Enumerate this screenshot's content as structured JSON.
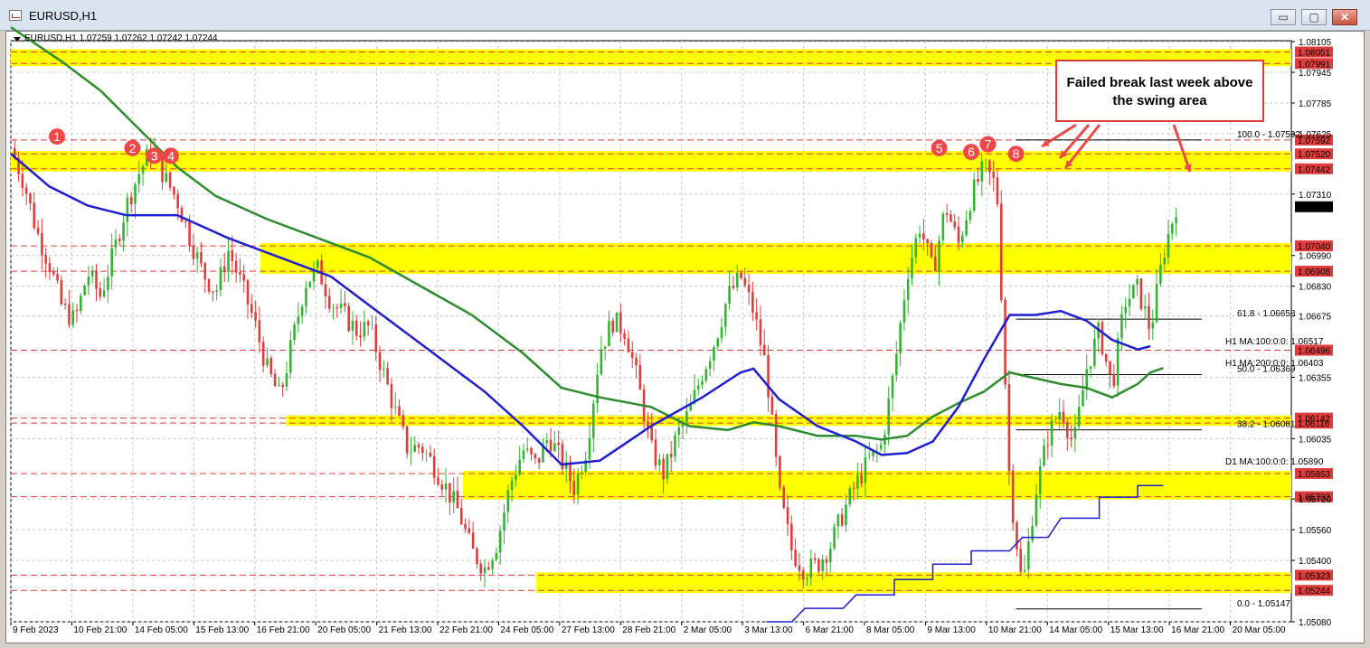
{
  "window": {
    "title": "EURUSD,H1",
    "header_symbol": "EURUSD,H1",
    "header_ohlc": "1.07259 1.07262 1.07242 1.07244",
    "minimize_glyph": "▭",
    "restore_glyph": "▢",
    "close_glyph": "✕"
  },
  "colors": {
    "bull": "#32b432",
    "bear": "#e03c3c",
    "ma100": "#1e1ed2",
    "ma200": "#2d8c2d",
    "zone": "#ffff00",
    "marker": "#f04848"
  },
  "chart_data": {
    "type": "candlestick",
    "symbol": "EURUSD",
    "timeframe": "H1",
    "last_price": "1.07244",
    "ylim": [
      1.0508,
      1.0811
    ],
    "y_ticks": [
      "1.08105",
      "1.07945",
      "1.07785",
      "1.07625",
      "1.07310",
      "1.06990",
      "1.06830",
      "1.06675",
      "1.06355",
      "1.06035",
      "1.05720",
      "1.05560",
      "1.05400",
      "1.05080"
    ],
    "x_ticks": [
      "9 Feb 2023",
      "10 Feb 21:00",
      "14 Feb 05:00",
      "15 Feb 13:00",
      "16 Feb 21:00",
      "20 Feb 05:00",
      "21 Feb 13:00",
      "22 Feb 21:00",
      "24 Feb 05:00",
      "27 Feb 13:00",
      "28 Feb 21:00",
      "2 Mar 05:00",
      "3 Mar 13:00",
      "6 Mar 21:00",
      "8 Mar 05:00",
      "9 Mar 13:00",
      "10 Mar 21:00",
      "14 Mar 05:00",
      "15 Mar 13:00",
      "16 Mar 21:00",
      "20 Mar 05:00"
    ],
    "price_labels": [
      "1.08051",
      "1.07991",
      "1.07592",
      "1.07520",
      "1.07442",
      "1.07040",
      "1.06908",
      "1.06496",
      "1.06142",
      "1.06116",
      "1.05853",
      "1.05732",
      "1.05323",
      "1.05244"
    ],
    "zones": [
      {
        "low": 1.07991,
        "high": 1.08051,
        "from": 0.0
      },
      {
        "low": 1.07442,
        "high": 1.0752,
        "from": 0.0
      },
      {
        "low": 1.06908,
        "high": 1.0704,
        "from": 0.195
      },
      {
        "low": 1.06116,
        "high": 1.06142,
        "from": 0.215
      },
      {
        "low": 1.05732,
        "high": 1.05853,
        "from": 0.353
      },
      {
        "low": 1.05244,
        "high": 1.05323,
        "from": 0.41
      }
    ],
    "fibonacci": [
      {
        "label": "100.0 - 1.07592",
        "level": 1.07592
      },
      {
        "label": "61.8 - 1.06658",
        "level": 1.06658
      },
      {
        "label": "50.0 - 1.06369",
        "level": 1.06369
      },
      {
        "label": "38.2 - 1.06081",
        "level": 1.06081
      },
      {
        "label": "0.0 - 1.05147",
        "level": 1.05147
      }
    ],
    "indicators": [
      {
        "label": "H1 MA:100:0:0: 1.06517",
        "value": 1.06517,
        "color": "#1e1ed2"
      },
      {
        "label": "H1 MA:200:0:0: 1.06403",
        "value": 1.06403,
        "color": "#2d8c2d"
      },
      {
        "label": "D1 MA:100:0:0: 1.05890",
        "value": 1.0589,
        "color": "#1e1ed2"
      }
    ],
    "close_path": [
      [
        0,
        1.0755
      ],
      [
        0.01,
        1.0738
      ],
      [
        0.02,
        1.0712
      ],
      [
        0.03,
        1.0695
      ],
      [
        0.04,
        1.0672
      ],
      [
        0.05,
        1.0665
      ],
      [
        0.06,
        1.069
      ],
      [
        0.07,
        1.0678
      ],
      [
        0.08,
        1.07
      ],
      [
        0.09,
        1.0725
      ],
      [
        0.1,
        1.0742
      ],
      [
        0.11,
        1.0755
      ],
      [
        0.12,
        1.074
      ],
      [
        0.13,
        1.0728
      ],
      [
        0.14,
        1.0708
      ],
      [
        0.15,
        1.069
      ],
      [
        0.16,
        1.068
      ],
      [
        0.17,
        1.0702
      ],
      [
        0.18,
        1.0684
      ],
      [
        0.19,
        1.0665
      ],
      [
        0.2,
        1.064
      ],
      [
        0.21,
        1.0625
      ],
      [
        0.22,
        1.0655
      ],
      [
        0.23,
        1.0685
      ],
      [
        0.24,
        1.0692
      ],
      [
        0.25,
        1.0675
      ],
      [
        0.26,
        1.0668
      ],
      [
        0.27,
        1.066
      ],
      [
        0.28,
        1.0662
      ],
      [
        0.29,
        1.064
      ],
      [
        0.3,
        1.0618
      ],
      [
        0.31,
        1.0598
      ],
      [
        0.32,
        1.06
      ],
      [
        0.33,
        1.059
      ],
      [
        0.34,
        1.0578
      ],
      [
        0.35,
        1.0565
      ],
      [
        0.36,
        1.0545
      ],
      [
        0.37,
        1.0536
      ],
      [
        0.38,
        1.055
      ],
      [
        0.39,
        1.058
      ],
      [
        0.4,
        1.0598
      ],
      [
        0.41,
        1.059
      ],
      [
        0.42,
        1.0605
      ],
      [
        0.43,
        1.0592
      ],
      [
        0.44,
        1.0578
      ],
      [
        0.45,
        1.06
      ],
      [
        0.46,
        1.065
      ],
      [
        0.47,
        1.0665
      ],
      [
        0.48,
        1.066
      ],
      [
        0.49,
        1.0632
      ],
      [
        0.5,
        1.0598
      ],
      [
        0.51,
        1.0585
      ],
      [
        0.52,
        1.0605
      ],
      [
        0.53,
        1.0618
      ],
      [
        0.54,
        1.0638
      ],
      [
        0.55,
        1.0655
      ],
      [
        0.56,
        1.0678
      ],
      [
        0.57,
        1.0688
      ],
      [
        0.58,
        1.067
      ],
      [
        0.59,
        1.064
      ],
      [
        0.6,
        1.0575
      ],
      [
        0.61,
        1.0545
      ],
      [
        0.62,
        1.0535
      ],
      [
        0.63,
        1.0538
      ],
      [
        0.64,
        1.0548
      ],
      [
        0.65,
        1.0565
      ],
      [
        0.66,
        1.058
      ],
      [
        0.67,
        1.0592
      ],
      [
        0.68,
        1.06
      ],
      [
        0.69,
        1.064
      ],
      [
        0.7,
        1.069
      ],
      [
        0.71,
        1.0715
      ],
      [
        0.72,
        1.069
      ],
      [
        0.73,
        1.0725
      ],
      [
        0.74,
        1.0705
      ],
      [
        0.75,
        1.073
      ],
      [
        0.76,
        1.0745
      ],
      [
        0.77,
        1.0735
      ],
      [
        0.78,
        1.058
      ],
      [
        0.79,
        1.0525
      ],
      [
        0.8,
        1.0575
      ],
      [
        0.81,
        1.0605
      ],
      [
        0.82,
        1.062
      ],
      [
        0.83,
        1.06
      ],
      [
        0.84,
        1.064
      ],
      [
        0.85,
        1.066
      ],
      [
        0.86,
        1.063
      ],
      [
        0.87,
        1.0675
      ],
      [
        0.88,
        1.0682
      ],
      [
        0.89,
        1.066
      ],
      [
        0.9,
        1.07
      ],
      [
        0.91,
        1.0725
      ]
    ],
    "ma100_path": [
      [
        0,
        1.0752
      ],
      [
        0.03,
        1.0735
      ],
      [
        0.06,
        1.0725
      ],
      [
        0.09,
        1.072
      ],
      [
        0.13,
        1.072
      ],
      [
        0.17,
        1.0708
      ],
      [
        0.21,
        1.0698
      ],
      [
        0.25,
        1.0688
      ],
      [
        0.29,
        1.0668
      ],
      [
        0.33,
        1.0648
      ],
      [
        0.37,
        1.0628
      ],
      [
        0.4,
        1.061
      ],
      [
        0.43,
        1.059
      ],
      [
        0.46,
        1.0592
      ],
      [
        0.5,
        1.061
      ],
      [
        0.54,
        1.0625
      ],
      [
        0.57,
        1.0638
      ],
      [
        0.58,
        1.064
      ],
      [
        0.6,
        1.0624
      ],
      [
        0.63,
        1.061
      ],
      [
        0.66,
        1.0602
      ],
      [
        0.68,
        1.0595
      ],
      [
        0.7,
        1.0596
      ],
      [
        0.72,
        1.0602
      ],
      [
        0.74,
        1.062
      ],
      [
        0.76,
        1.0645
      ],
      [
        0.78,
        1.0668
      ],
      [
        0.8,
        1.0668
      ],
      [
        0.82,
        1.067
      ],
      [
        0.84,
        1.0665
      ],
      [
        0.86,
        1.0655
      ],
      [
        0.88,
        1.065
      ],
      [
        0.89,
        1.06517
      ]
    ],
    "ma200_path": [
      [
        0,
        1.0818
      ],
      [
        0.04,
        1.08
      ],
      [
        0.07,
        1.0785
      ],
      [
        0.1,
        1.0765
      ],
      [
        0.13,
        1.0745
      ],
      [
        0.16,
        1.073
      ],
      [
        0.2,
        1.0718
      ],
      [
        0.24,
        1.0708
      ],
      [
        0.28,
        1.0698
      ],
      [
        0.32,
        1.0683
      ],
      [
        0.36,
        1.0668
      ],
      [
        0.4,
        1.0648
      ],
      [
        0.43,
        1.063
      ],
      [
        0.46,
        1.0625
      ],
      [
        0.5,
        1.062
      ],
      [
        0.53,
        1.061
      ],
      [
        0.56,
        1.0608
      ],
      [
        0.58,
        1.0612
      ],
      [
        0.6,
        1.061
      ],
      [
        0.63,
        1.0605
      ],
      [
        0.66,
        1.0605
      ],
      [
        0.68,
        1.0603
      ],
      [
        0.7,
        1.0605
      ],
      [
        0.72,
        1.0615
      ],
      [
        0.74,
        1.0622
      ],
      [
        0.76,
        1.0628
      ],
      [
        0.78,
        1.0638
      ],
      [
        0.8,
        1.0635
      ],
      [
        0.82,
        1.0632
      ],
      [
        0.84,
        1.063
      ],
      [
        0.86,
        1.0625
      ],
      [
        0.88,
        1.0632
      ],
      [
        0.89,
        1.0638
      ],
      [
        0.9,
        1.06403
      ]
    ],
    "d1ma_path": [
      [
        0.59,
        1.0508
      ],
      [
        0.61,
        1.0508
      ],
      [
        0.62,
        1.0515
      ],
      [
        0.65,
        1.0515
      ],
      [
        0.66,
        1.0522
      ],
      [
        0.69,
        1.0522
      ],
      [
        0.69,
        1.053
      ],
      [
        0.72,
        1.053
      ],
      [
        0.72,
        1.0538
      ],
      [
        0.75,
        1.0538
      ],
      [
        0.75,
        1.0545
      ],
      [
        0.78,
        1.0545
      ],
      [
        0.79,
        1.0552
      ],
      [
        0.81,
        1.0552
      ],
      [
        0.82,
        1.0562
      ],
      [
        0.85,
        1.0562
      ],
      [
        0.85,
        1.0573
      ],
      [
        0.88,
        1.0573
      ],
      [
        0.88,
        1.0579
      ],
      [
        0.9,
        1.0579
      ]
    ],
    "markers": [
      {
        "label": "1",
        "x": 0.036,
        "price": 1.0761
      },
      {
        "label": "2",
        "x": 0.095,
        "price": 1.0755
      },
      {
        "label": "3",
        "x": 0.112,
        "price": 1.0751
      },
      {
        "label": "4",
        "x": 0.125,
        "price": 1.0751
      },
      {
        "label": "5",
        "x": 0.725,
        "price": 1.0755
      },
      {
        "label": "6",
        "x": 0.75,
        "price": 1.0753
      },
      {
        "label": "7",
        "x": 0.763,
        "price": 1.0757
      },
      {
        "label": "8",
        "x": 0.785,
        "price": 1.0752
      }
    ],
    "annotation": "Failed break last week above the swing area"
  }
}
